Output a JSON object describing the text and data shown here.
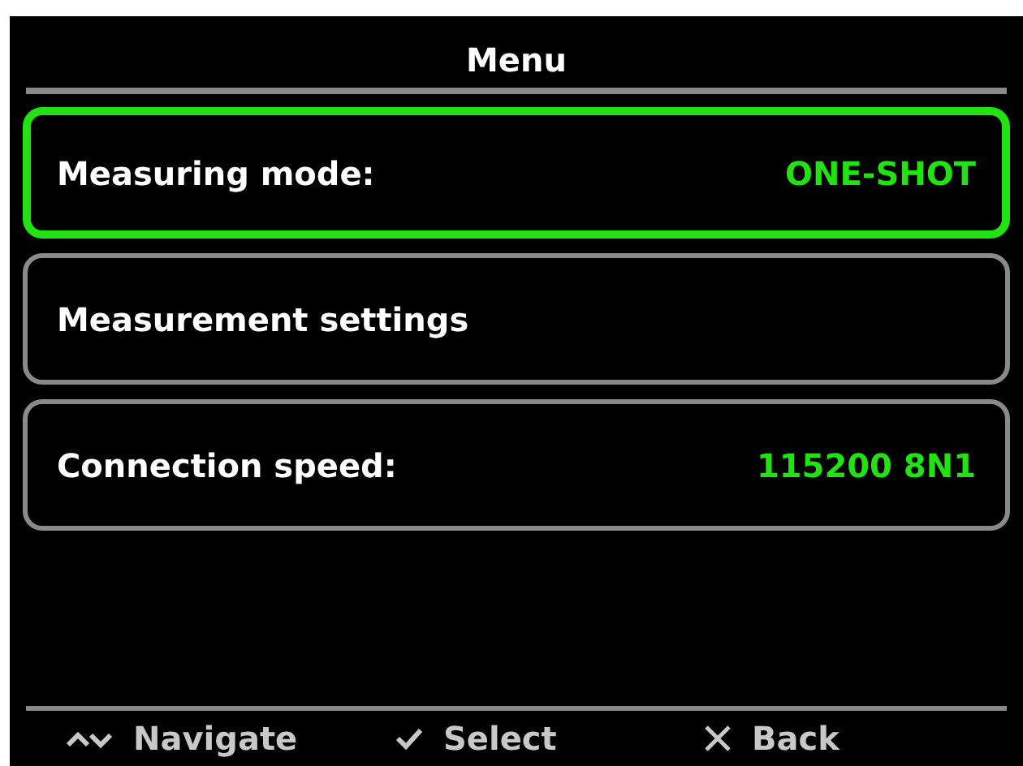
{
  "title": "Menu",
  "items": [
    {
      "label": "Measuring mode:",
      "value": "ONE-SHOT",
      "selected": true
    },
    {
      "label": "Measurement settings",
      "selected": false
    },
    {
      "label": "Connection speed:",
      "value": "115200 8N1",
      "selected": false
    }
  ],
  "hints": [
    {
      "kind": "navigate",
      "label": "Navigate"
    },
    {
      "kind": "select",
      "label": "Select"
    },
    {
      "kind": "back",
      "label": "Back"
    }
  ]
}
